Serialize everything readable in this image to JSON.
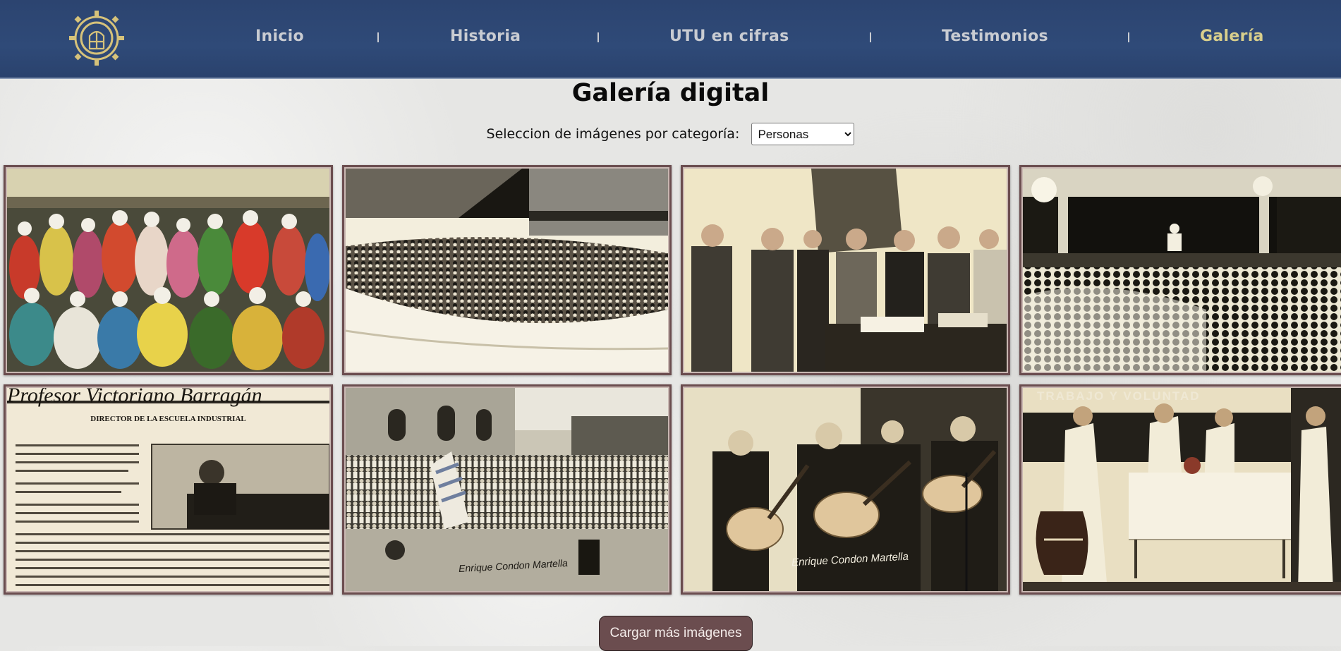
{
  "nav": {
    "logo_icon": "school-gear-emblem",
    "items": [
      {
        "label": "Inicio",
        "active": false
      },
      {
        "label": "Historia",
        "active": false
      },
      {
        "label": "UTU en cifras",
        "active": false
      },
      {
        "label": "Testimonios",
        "active": false
      },
      {
        "label": "Galería",
        "active": true
      }
    ],
    "active_color": "#d9cf8c",
    "bar_color": "#2f4a78"
  },
  "main": {
    "title": "Galería digital",
    "filter": {
      "label": "Seleccion de imágenes por categoría:",
      "selected": "Personas"
    }
  },
  "gallery": {
    "photos": [
      {
        "caption": "",
        "scene": "costumed-group-color"
      },
      {
        "caption": "",
        "scene": "crowd-audience"
      },
      {
        "caption": "",
        "scene": "men-at-desk"
      },
      {
        "caption": "",
        "scene": "stage-performance"
      },
      {
        "caption": "",
        "scene": "newspaper-clipping"
      },
      {
        "caption": "Enrique Condon Martella",
        "scene": "flag-ceremony"
      },
      {
        "caption": "Enrique Condon Martella",
        "scene": "guitar-players"
      },
      {
        "caption": "",
        "scene": "theater-table"
      }
    ],
    "clipping": {
      "headline": "Profesor Victoriano Barragán",
      "subhead": "DIRECTOR DE LA ESCUELA INDUSTRIAL"
    },
    "theater_sign": "TRABAJO Y VOLUNTAD",
    "frame_color": "#6b4d4f"
  },
  "load_more": {
    "label": "Cargar más imágenes"
  }
}
